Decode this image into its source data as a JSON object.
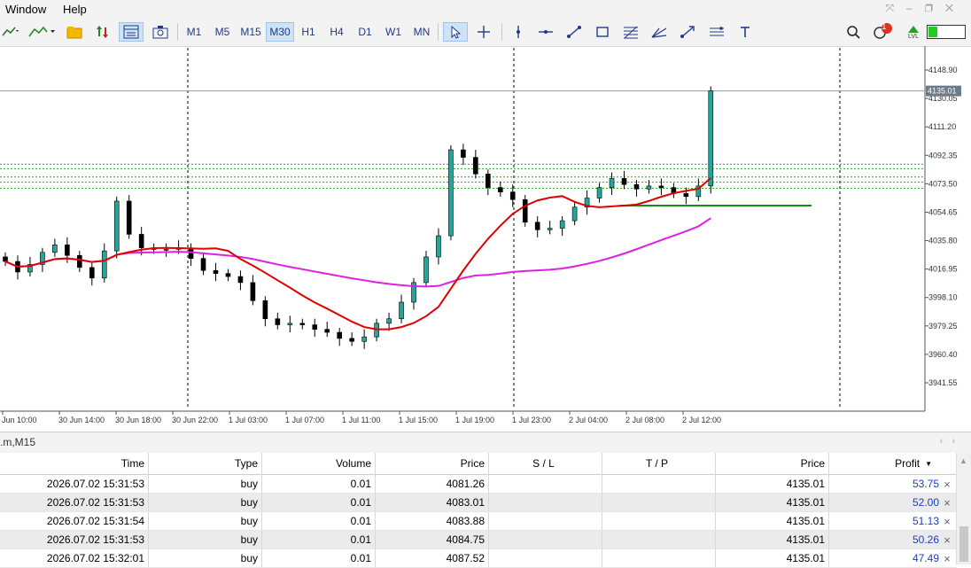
{
  "menu": {
    "items": [
      "Window",
      "Help"
    ]
  },
  "toolbar": {
    "timeframes": [
      "M1",
      "M5",
      "M15",
      "M30",
      "H1",
      "H4",
      "D1",
      "W1",
      "MN"
    ],
    "active_timeframe": "M30",
    "notification_count": "1",
    "level_label": "LVL",
    "icons": [
      "indicators-icon",
      "line-chart-icon",
      "folder-icon",
      "algo-trading-icon",
      "chart-template-icon",
      "screenshot-icon",
      "cursor-icon",
      "crosshair-icon",
      "vertical-line-icon",
      "horizontal-line-icon",
      "trendline-icon",
      "rectangle-icon",
      "fibonacci-icon",
      "pitchfork-icon",
      "arrow-icon",
      "channel-icon",
      "text-icon",
      "search-icon",
      "notification-icon",
      "signal-level-icon"
    ]
  },
  "chart": {
    "price_axis": [
      "4148.90",
      "4130.05",
      "4111.20",
      "4092.35",
      "4073.50",
      "4054.65",
      "4035.80",
      "4016.95",
      "3998.10",
      "3979.25",
      "3960.40",
      "3941.55"
    ],
    "current_price": "4135.01",
    "time_axis": [
      "Jun 10:00",
      "30 Jun 14:00",
      "30 Jun 18:00",
      "30 Jun 22:00",
      "1 Jul 03:00",
      "1 Jul 07:00",
      "1 Jul 11:00",
      "1 Jul 15:00",
      "1 Jul 19:00",
      "1 Jul 23:00",
      "2 Jul 04:00",
      "2 Jul 08:00",
      "2 Jul 12:00"
    ],
    "colors": {
      "bull": "#26a69a",
      "bear": "#000000",
      "ma_fast": "#e00000",
      "ma_slow": "#e020e0",
      "level_lines": "#22b022",
      "grid": "#000000"
    }
  },
  "chart_data": {
    "type": "candlestick",
    "series": [
      {
        "name": "",
        "values": [
          4022,
          4015,
          4020,
          4028,
          4033,
          4026,
          4018,
          4011,
          4029,
          4062,
          4040,
          4031,
          4030,
          4030,
          4031,
          4024,
          4016,
          4014,
          4012,
          4008,
          3996,
          3984,
          3980,
          3981,
          3980,
          3977,
          3975,
          3971,
          3969,
          3972,
          3981,
          3984,
          3995,
          4008,
          4025,
          4039,
          4096,
          4091,
          4080,
          4071,
          4068,
          4063,
          4048,
          4043,
          4044,
          4049,
          4058,
          4064,
          4071,
          4077,
          4073,
          4070,
          4072,
          4071,
          4067,
          4065,
          4072,
          4135
        ]
      }
    ],
    "ylim": [
      3941.55,
      4148.9
    ],
    "reference_lines": [
      4135.01,
      4086.5,
      4083.5,
      4078.0,
      4074.5,
      4070.5,
      4059.0
    ],
    "notes": "approximate close prices read from candlesticks"
  },
  "terminal": {
    "title": ".m,M15",
    "columns": [
      "Time",
      "Type",
      "Volume",
      "Price",
      "S / L",
      "T / P",
      "Price",
      "Profit"
    ],
    "sort_indicator": "▼",
    "rows": [
      {
        "time": "2026.07.02 15:31:53",
        "type": "buy",
        "volume": "0.01",
        "price": "4081.26",
        "sl": "",
        "tp": "",
        "cur_price": "4135.01",
        "profit": "53.75"
      },
      {
        "time": "2026.07.02 15:31:53",
        "type": "buy",
        "volume": "0.01",
        "price": "4083.01",
        "sl": "",
        "tp": "",
        "cur_price": "4135.01",
        "profit": "52.00"
      },
      {
        "time": "2026.07.02 15:31:54",
        "type": "buy",
        "volume": "0.01",
        "price": "4083.88",
        "sl": "",
        "tp": "",
        "cur_price": "4135.01",
        "profit": "51.13"
      },
      {
        "time": "2026.07.02 15:31:53",
        "type": "buy",
        "volume": "0.01",
        "price": "4084.75",
        "sl": "",
        "tp": "",
        "cur_price": "4135.01",
        "profit": "50.26"
      },
      {
        "time": "2026.07.02 15:32:01",
        "type": "buy",
        "volume": "0.01",
        "price": "4087.52",
        "sl": "",
        "tp": "",
        "cur_price": "4135.01",
        "profit": "47.49"
      }
    ],
    "close_icon": "×"
  }
}
